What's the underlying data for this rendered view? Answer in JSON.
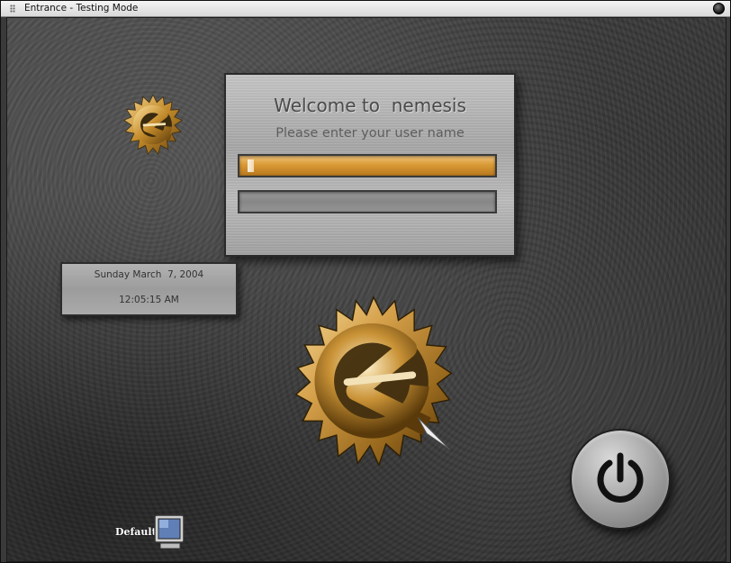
{
  "window": {
    "title": "Entrance - Testing Mode"
  },
  "login": {
    "welcome": "Welcome to  nemesis",
    "prompt": "Please enter your user name",
    "username_value": "",
    "password_value": ""
  },
  "clock": {
    "date": "Sunday March  7, 2004",
    "time": "12:05:15 AM"
  },
  "session": {
    "label": "Default",
    "icon": "monitor-icon"
  },
  "icons": {
    "logo": "enlightenment-e-logo-icon",
    "power": "power-icon",
    "close": "close-icon"
  },
  "colors": {
    "accent": "#d99a36",
    "logo_gold": "#c8902e",
    "panel": "#b4b4b4"
  }
}
